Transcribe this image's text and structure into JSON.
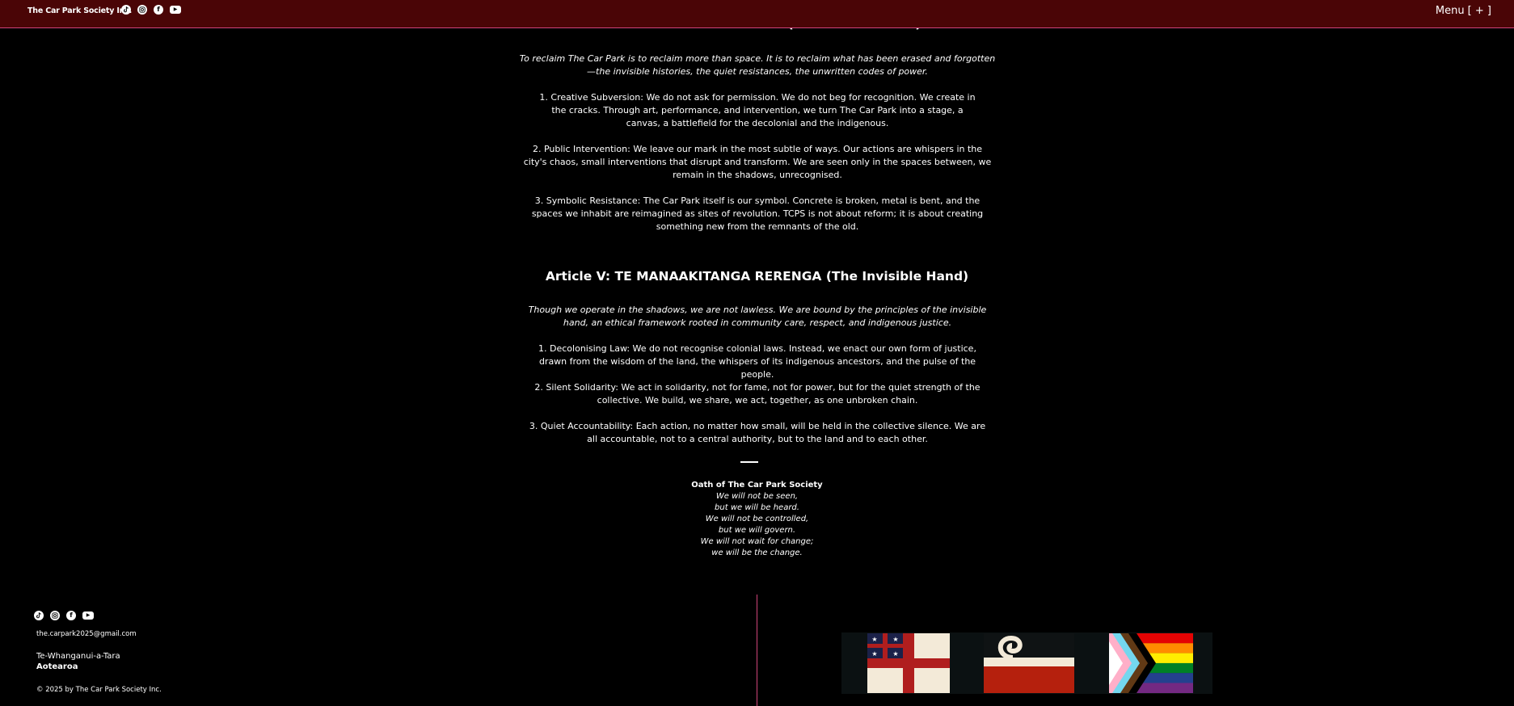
{
  "header": {
    "brand": "The Car Park Society Inc.",
    "menu_label": "Menu [ + ]",
    "socials": [
      "tiktok-icon",
      "instagram-icon",
      "facebook-icon",
      "youtube-icon"
    ]
  },
  "content": {
    "cut_heading": "Article IV: TE WHAKAHOKI (The Reclamation)",
    "intro_iv": "To reclaim The Car Park is to reclaim more than space. It is to reclaim what has been erased and forgotten —the invisible histories, the quiet resistances, the unwritten codes of power.",
    "iv_items": [
      "1. Creative Subversion: We do not ask for permission. We do not beg for recognition.  We create in the cracks. Through art, performance, and intervention, we turn The Car  Park into a stage, a canvas, a battlefield for the decolonial and the indigenous.",
      "2. Public Intervention: We leave our mark in the most subtle of ways. Our actions are  whispers in the city's chaos, small interventions that disrupt and transform. We are seen only in the spaces between, we remain in the shadows, unrecognised.",
      "3. Symbolic Resistance: The Car Park itself is our symbol. Concrete is broken, metal is bent, and the spaces we inhabit are reimagined as sites of revolution. TCPS is not about reform; it is about creating something new from the remnants of the old."
    ],
    "article_v_title": "Article V: TE MANAAKITANGA RERENGA (The Invisible Hand)",
    "intro_v": "Though we operate in the shadows, we are not lawless. We are bound by the principles of  the invisible hand, an ethical framework rooted in community care, respect, and indigenous  justice.",
    "v_items": [
      "1. Decolonising Law: We do not recognise colonial laws. Instead, we enact our own  form of justice, drawn from the wisdom of the land, the whispers of its indigenous  ancestors, and the pulse of the people.",
      "2. Silent Solidarity: We act in solidarity, not for fame, not for power, but for the quiet  strength of the collective. We build, we share, we act, together, as one unbroken  chain.",
      "3. Quiet Accountability: Each action, no matter how small, will be held in the collective  silence. We are all accountable, not to a central authority, but to the land and to  each other."
    ],
    "oath": {
      "title": "Oath of The Car Park Society",
      "lines": [
        "We will not be seen,",
        "but we will be heard.",
        "We will not be controlled,",
        "but we will govern.",
        "We will not wait for change;",
        "we will be the change."
      ]
    }
  },
  "footer": {
    "socials": [
      "tiktok-icon",
      "instagram-icon",
      "facebook-icon",
      "youtube-icon"
    ],
    "email": "the.carpark2025@gmail.com",
    "city": "Te-Whanganui-a-Tara",
    "country": "Aotearoa",
    "copyright": "© 2025 by The Car Park Society Inc.",
    "flags": [
      "united-tribes-flag",
      "tino-rangatiratanga-flag",
      "progress-pride-flag"
    ]
  },
  "colors": {
    "header_bg": "#4a0506",
    "accent_line": "#d0447a",
    "background": "#000000",
    "text": "#ffffff"
  }
}
